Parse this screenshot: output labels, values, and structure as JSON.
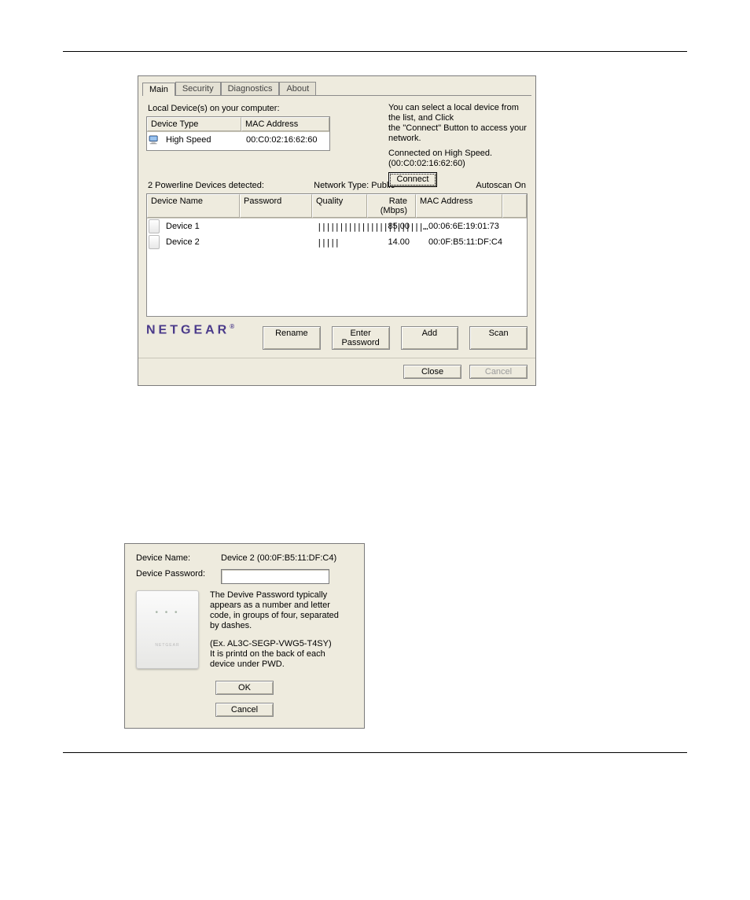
{
  "tabs": {
    "main": "Main",
    "security": "Security",
    "diagnostics": "Diagnostics",
    "about": "About"
  },
  "local_label": "Local Device(s) on your computer:",
  "local_cols": {
    "type": "Device Type",
    "mac": "MAC Address"
  },
  "local_row": {
    "type": "High Speed",
    "mac": "00:C0:02:16:62:60"
  },
  "tip_line1": "You can select a local device from the list, and Click",
  "tip_line2": "the \"Connect\" Button to access your network.",
  "connected_label": "Connected on  High Speed. (00:C0:02:16:62:60)",
  "connect_btn": "Connect",
  "status": {
    "detected": "2 Powerline Devices detected:",
    "nettype": "Network Type: Public",
    "autoscan": "Autoscan On"
  },
  "dev_cols": {
    "name": "Device Name",
    "pass": "Password",
    "qual": "Quality",
    "rate": "Rate (Mbps)",
    "mac": "MAC Address"
  },
  "devices": [
    {
      "name": "Device 1",
      "qual": "||||||||||||||||||||||||…",
      "rate": "85.00",
      "mac": "00:06:6E:19:01:73"
    },
    {
      "name": "Device 2",
      "qual": "|||||",
      "rate": "14.00",
      "mac": "00:0F:B5:11:DF:C4"
    }
  ],
  "logo": "NETGEAR",
  "actions": {
    "rename": "Rename",
    "enterpw": "Enter Password",
    "add": "Add",
    "scan": "Scan"
  },
  "footer": {
    "close": "Close",
    "cancel": "Cancel"
  },
  "dlg": {
    "name_lbl": "Device Name:",
    "name_val": "Device 2  (00:0F:B5:11:DF:C4)",
    "pw_lbl": "Device Password:",
    "help1": "The Devive Password typically appears as a number and letter code, in groups of four, separated by dashes.",
    "help2": "(Ex. AL3C-SEGP-VWG5-T4SY)",
    "help3": "It is printd on the back of each device under PWD.",
    "ok": "OK",
    "cancel": "Cancel"
  }
}
